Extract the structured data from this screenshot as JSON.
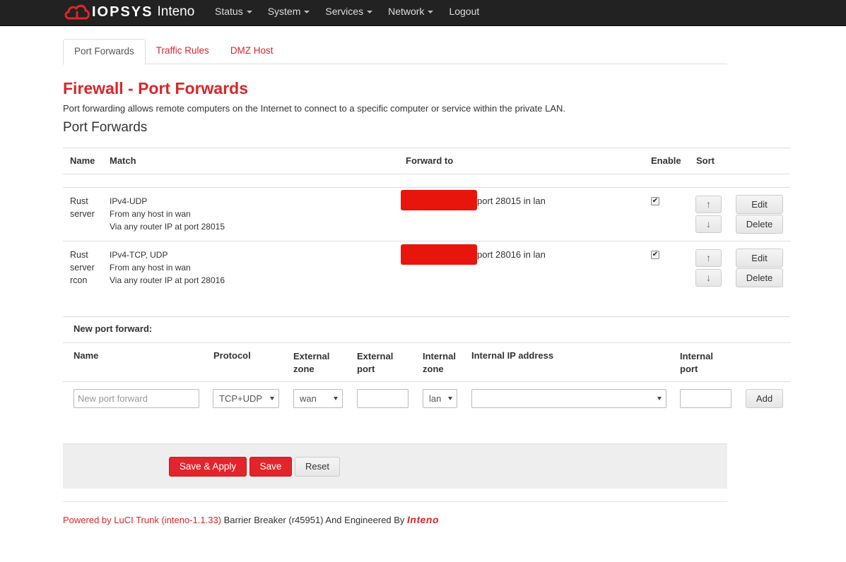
{
  "navbar": {
    "brand_name": "IOPSYS",
    "brand_product": "Inteno",
    "menu": [
      {
        "label": "Status",
        "has_caret": true
      },
      {
        "label": "System",
        "has_caret": true
      },
      {
        "label": "Services",
        "has_caret": true
      },
      {
        "label": "Network",
        "has_caret": true
      },
      {
        "label": "Logout",
        "has_caret": false
      }
    ]
  },
  "tabs": [
    {
      "label": "Port Forwards",
      "active": true
    },
    {
      "label": "Traffic Rules",
      "active": false
    },
    {
      "label": "DMZ Host",
      "active": false
    }
  ],
  "page": {
    "title": "Firewall - Port Forwards",
    "description": "Port forwarding allows remote computers on the Internet to connect to a specific computer or service within the private LAN.",
    "section_title": "Port Forwards"
  },
  "table": {
    "headers": {
      "name": "Name",
      "match": "Match",
      "forward_to": "Forward to",
      "enable": "Enable",
      "sort": "Sort"
    },
    "rows": [
      {
        "name_lines": [
          "Rust",
          "server"
        ],
        "match_lines": [
          "IPv4-UDP",
          "From any host in wan",
          "Via any router IP at port 28015"
        ],
        "forward_to": "port 28015 in lan",
        "enabled": true
      },
      {
        "name_lines": [
          "Rust",
          "server",
          "rcon"
        ],
        "match_lines": [
          "IPv4-TCP, UDP",
          "From any host in wan",
          "Via any router IP at port 28016"
        ],
        "forward_to": "port 28016 in lan",
        "enabled": true
      }
    ],
    "sort_up": "↑",
    "sort_down": "↓",
    "edit_label": "Edit",
    "delete_label": "Delete",
    "checkmark": "✔"
  },
  "new_forward": {
    "title": "New port forward:",
    "headers": {
      "name": "Name",
      "protocol": "Protocol",
      "external_zone_1": "External",
      "external_zone_2": "zone",
      "external_port_1": "External",
      "external_port_2": "port",
      "internal_zone_1": "Internal",
      "internal_zone_2": "zone",
      "internal_ip": "Internal IP address",
      "internal_port_1": "Internal",
      "internal_port_2": "port"
    },
    "name_placeholder": "New port forward",
    "protocol_value": "TCP+UDP",
    "external_zone_value": "wan",
    "external_port_value": "",
    "internal_zone_value": "lan",
    "internal_ip_value": "",
    "internal_port_value": "",
    "add_label": "Add"
  },
  "actions": {
    "save_apply": "Save & Apply",
    "save": "Save",
    "reset": "Reset"
  },
  "footer": {
    "powered_by": "Powered by LuCI Trunk (inteno-1.1.33)",
    "middle": " Barrier Breaker (r45951) And Engineered By ",
    "logo_text": "Inteno"
  },
  "colors": {
    "accent": "#d9262a",
    "navbar_bg": "#222222",
    "redaction": "#e8150d"
  }
}
